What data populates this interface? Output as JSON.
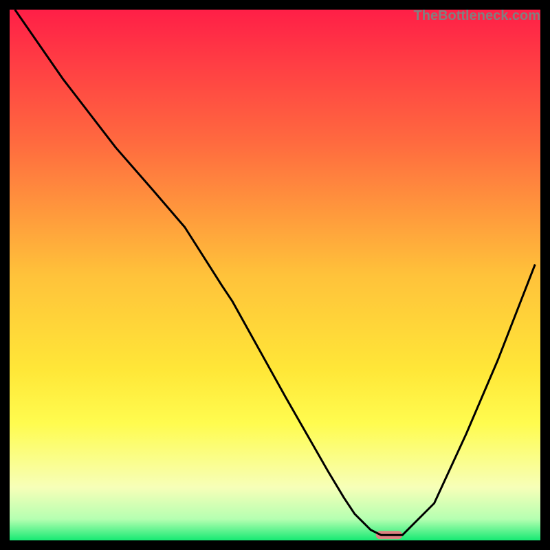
{
  "watermark": "TheBottleneck.com",
  "chart_data": {
    "type": "line",
    "title": "",
    "xlabel": "",
    "ylabel": "",
    "xlim": [
      0,
      100
    ],
    "ylim": [
      0,
      100
    ],
    "grid": false,
    "series": [
      {
        "name": "curve",
        "x": [
          1,
          10,
          20,
          27,
          33,
          40,
          42,
          47,
          52,
          56,
          60,
          63,
          65,
          68,
          70,
          74,
          80,
          86,
          92,
          99
        ],
        "values": [
          100,
          87,
          74,
          66,
          59,
          48,
          45,
          36,
          27,
          20,
          13,
          8,
          5,
          2,
          1,
          1,
          7,
          20,
          34,
          52
        ]
      }
    ],
    "marker": {
      "name": "optimal-point",
      "x_range": [
        69,
        74
      ],
      "y": 1,
      "color": "#dc8181"
    },
    "background_gradient": {
      "stops": [
        {
          "pct": 0,
          "color": "#ff1f47"
        },
        {
          "pct": 25,
          "color": "#ff6a3f"
        },
        {
          "pct": 50,
          "color": "#ffc23a"
        },
        {
          "pct": 68,
          "color": "#ffe738"
        },
        {
          "pct": 78,
          "color": "#fffc4f"
        },
        {
          "pct": 90,
          "color": "#f7ffb8"
        },
        {
          "pct": 96,
          "color": "#b5ffb1"
        },
        {
          "pct": 100,
          "color": "#16e973"
        }
      ]
    }
  }
}
